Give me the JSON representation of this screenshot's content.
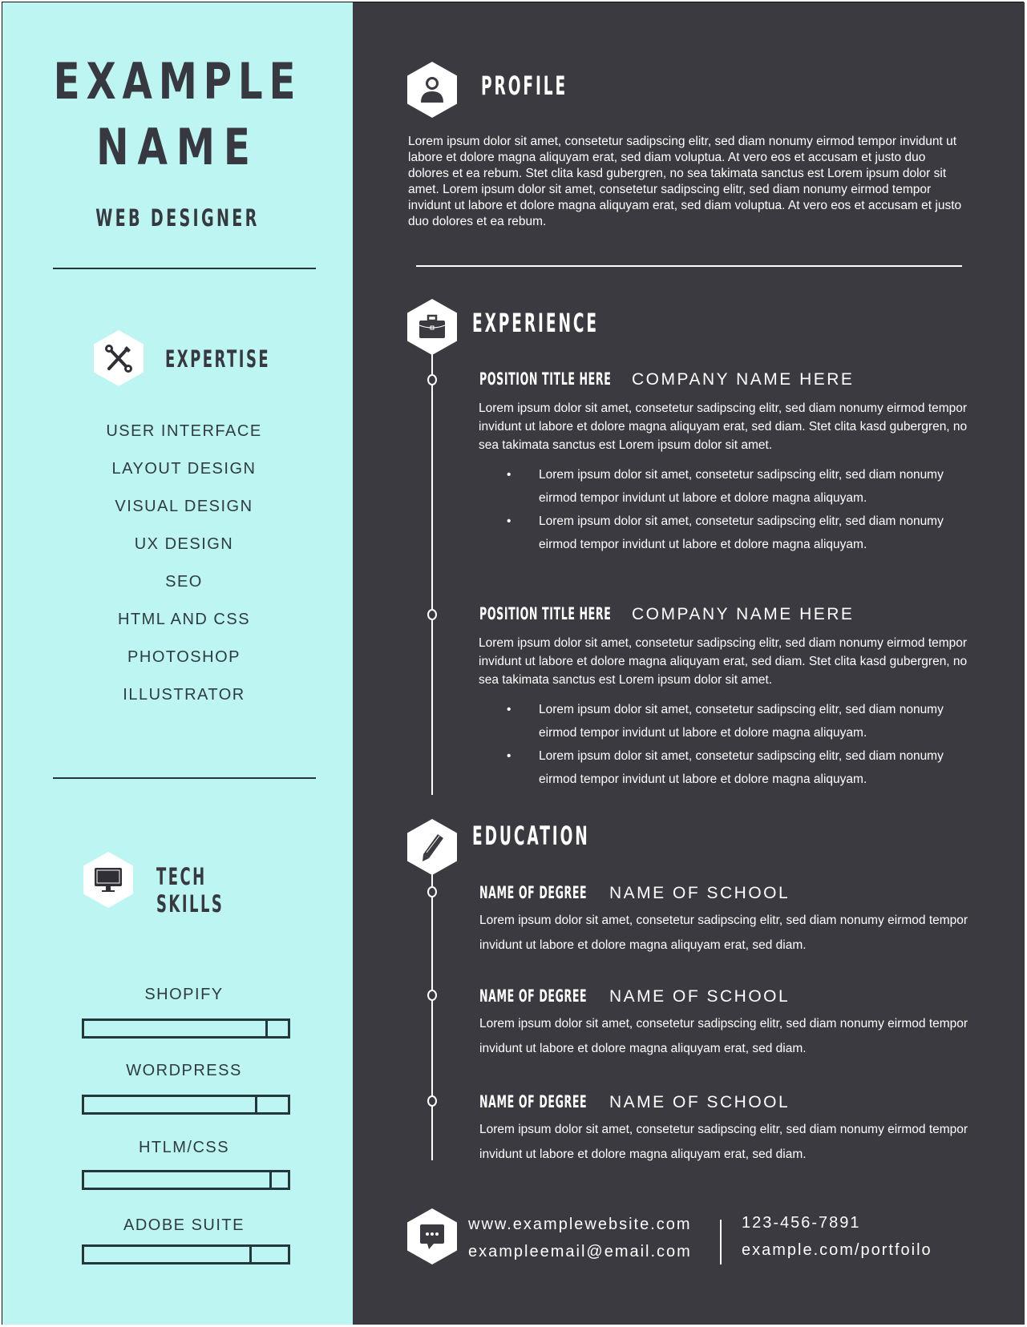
{
  "colors": {
    "sidebar_bg": "#bcf5f1",
    "main_bg": "#3a3a40",
    "sidebar_text": "#383840",
    "main_text": "#ffffff"
  },
  "header": {
    "name_line1": "EXAMPLE",
    "name_line2": "NAME",
    "job_title": "WEB DESIGNER"
  },
  "expertise": {
    "icon": "tools-icon",
    "heading": "EXPERTISE",
    "items": [
      "USER INTERFACE",
      "LAYOUT DESIGN",
      "VISUAL DESIGN",
      "UX DESIGN",
      "SEO",
      "HTML AND CSS",
      "PHOTOSHOP",
      "ILLUSTRATOR"
    ]
  },
  "tech_skills": {
    "icon": "monitor-icon",
    "heading": "TECH SKILLS",
    "skills": [
      {
        "label": "SHOPIFY",
        "level": 0.89
      },
      {
        "label": "WORDPRESS",
        "level": 0.84
      },
      {
        "label": "HTLM/CSS",
        "level": 0.91
      },
      {
        "label": "ADOBE SUITE",
        "level": 0.81
      }
    ]
  },
  "profile": {
    "icon": "user-icon",
    "heading": "PROFILE",
    "text": "Lorem ipsum dolor sit amet, consetetur sadipscing elitr, sed diam nonumy eirmod tempor invidunt ut labore et dolore magna aliquyam erat, sed diam voluptua. At vero eos et accusam et justo duo dolores et ea rebum. Stet clita kasd gubergren, no sea takimata sanctus est Lorem ipsum dolor sit amet. Lorem ipsum dolor sit amet, consetetur sadipscing elitr, sed diam nonumy eirmod tempor invidunt ut labore et dolore magna aliquyam erat, sed diam voluptua. At vero eos et accusam et justo duo dolores et ea rebum."
  },
  "experience": {
    "icon": "briefcase-icon",
    "heading": "EXPERIENCE",
    "entries": [
      {
        "position": "POSITION TITLE HERE",
        "company": "COMPANY NAME HERE",
        "description": "Lorem ipsum dolor sit amet, consetetur sadipscing elitr, sed diam nonumy eirmod tempor invidunt ut labore et dolore magna aliquyam erat, sed diam. Stet clita kasd gubergren, no sea takimata sanctus est Lorem ipsum dolor sit amet.",
        "bullets": [
          "Lorem ipsum dolor sit amet, consetetur sadipscing elitr, sed diam nonumy eirmod tempor invidunt ut labore et dolore magna aliquyam.",
          "Lorem ipsum dolor sit amet, consetetur sadipscing elitr, sed diam nonumy eirmod tempor invidunt ut labore et dolore magna aliquyam."
        ]
      },
      {
        "position": "POSITION TITLE HERE",
        "company": "COMPANY NAME HERE",
        "description": "Lorem ipsum dolor sit amet, consetetur sadipscing elitr, sed diam nonumy eirmod tempor invidunt ut labore et dolore magna aliquyam erat, sed diam. Stet clita kasd gubergren, no sea takimata sanctus est Lorem ipsum dolor sit amet.",
        "bullets": [
          "Lorem ipsum dolor sit amet, consetetur sadipscing elitr, sed diam nonumy eirmod tempor invidunt ut labore et dolore magna aliquyam.",
          "Lorem ipsum dolor sit amet, consetetur sadipscing elitr, sed diam nonumy eirmod tempor invidunt ut labore et dolore magna aliquyam."
        ]
      }
    ],
    "bullet_char": "•"
  },
  "education": {
    "icon": "pencil-icon",
    "heading": "EDUCATION",
    "entries": [
      {
        "degree": "NAME OF DEGREE",
        "school": "NAME OF SCHOOL",
        "description": "Lorem ipsum dolor sit amet, consetetur sadipscing elitr, sed diam nonumy eirmod tempor invidunt ut labore et dolore magna aliquyam erat, sed diam."
      },
      {
        "degree": "NAME OF DEGREE",
        "school": "NAME OF SCHOOL",
        "description": "Lorem ipsum dolor sit amet, consetetur sadipscing elitr, sed diam nonumy eirmod tempor invidunt ut labore et dolore magna aliquyam erat, sed diam."
      },
      {
        "degree": "NAME OF DEGREE",
        "school": "NAME OF SCHOOL",
        "description": "Lorem ipsum dolor sit amet, consetetur sadipscing elitr, sed diam nonumy eirmod tempor invidunt ut labore et dolore magna aliquyam erat, sed diam."
      }
    ]
  },
  "contact": {
    "icon": "chat-icon",
    "website": "www.examplewebsite.com",
    "email": "exampleemail@email.com",
    "phone": "123-456-7891",
    "portfolio": "example.com/portfoilo"
  }
}
